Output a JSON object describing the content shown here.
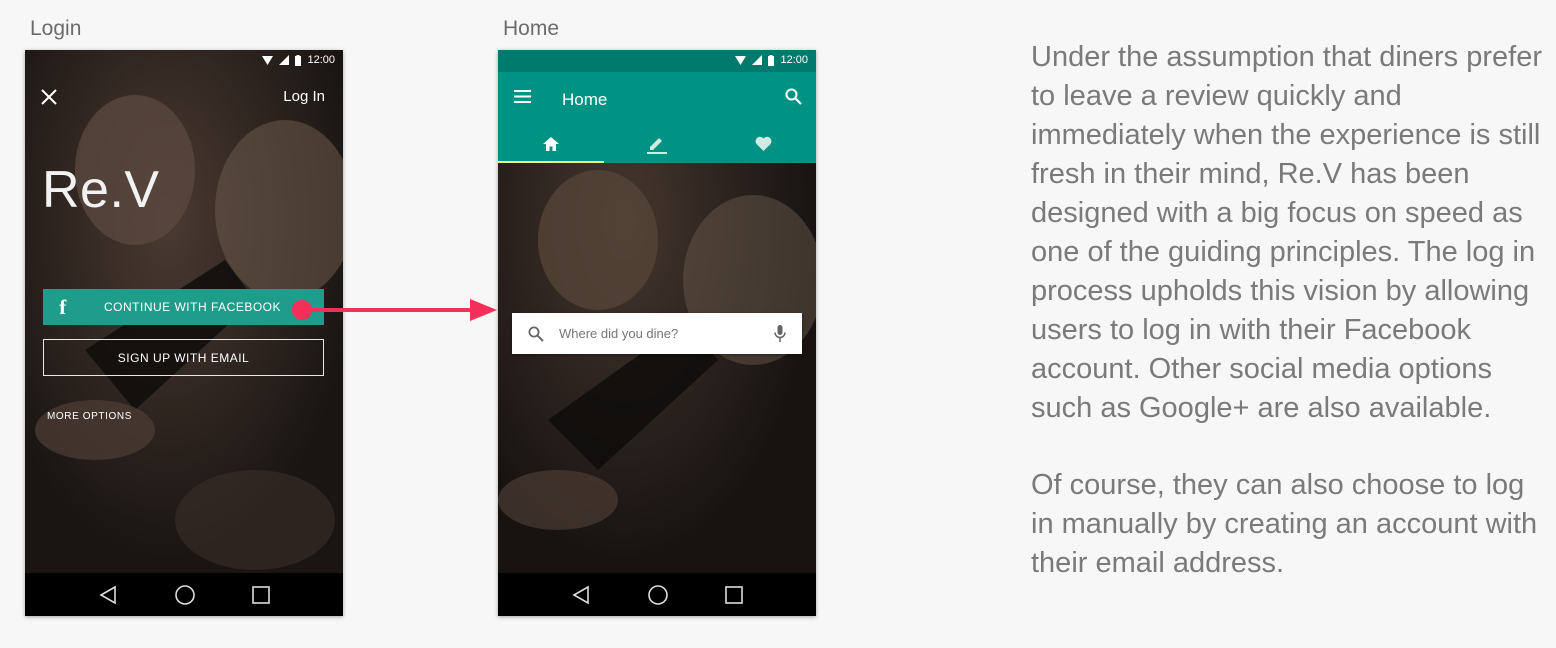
{
  "login_screen": {
    "caption": "Login",
    "status_time": "12:00",
    "login_link": "Log In",
    "brand": "Re.V",
    "facebook_button": "CONTINUE WITH FACEBOOK",
    "facebook_icon_glyph": "f",
    "email_button": "SIGN UP WITH EMAIL",
    "more_options": "MORE OPTIONS"
  },
  "home_screen": {
    "caption": "Home",
    "status_time": "12:00",
    "title": "Home",
    "tabs": [
      {
        "icon": "home-icon",
        "active": true
      },
      {
        "icon": "pencil-icon",
        "active": false
      },
      {
        "icon": "heart-icon",
        "active": false
      }
    ],
    "search_placeholder": "Where did you dine?"
  },
  "description": {
    "paragraph_1": "Under the assumption that diners prefer to leave a review quickly and immediately when the experience is still fresh in their mind, Re.V has been designed with a big focus on speed as one of the guiding principles. The log in process upholds this vision by allowing users to log in with their Facebook account. Other social media options such as Google+ are also available.",
    "paragraph_2": "Of course, they can also choose to log in manually by creating an account with their email address."
  },
  "colors": {
    "accent_teal": "#009383",
    "facebook_button": "#1f9d8a",
    "arrow": "#f2305a",
    "tab_indicator": "#e4f27a"
  }
}
